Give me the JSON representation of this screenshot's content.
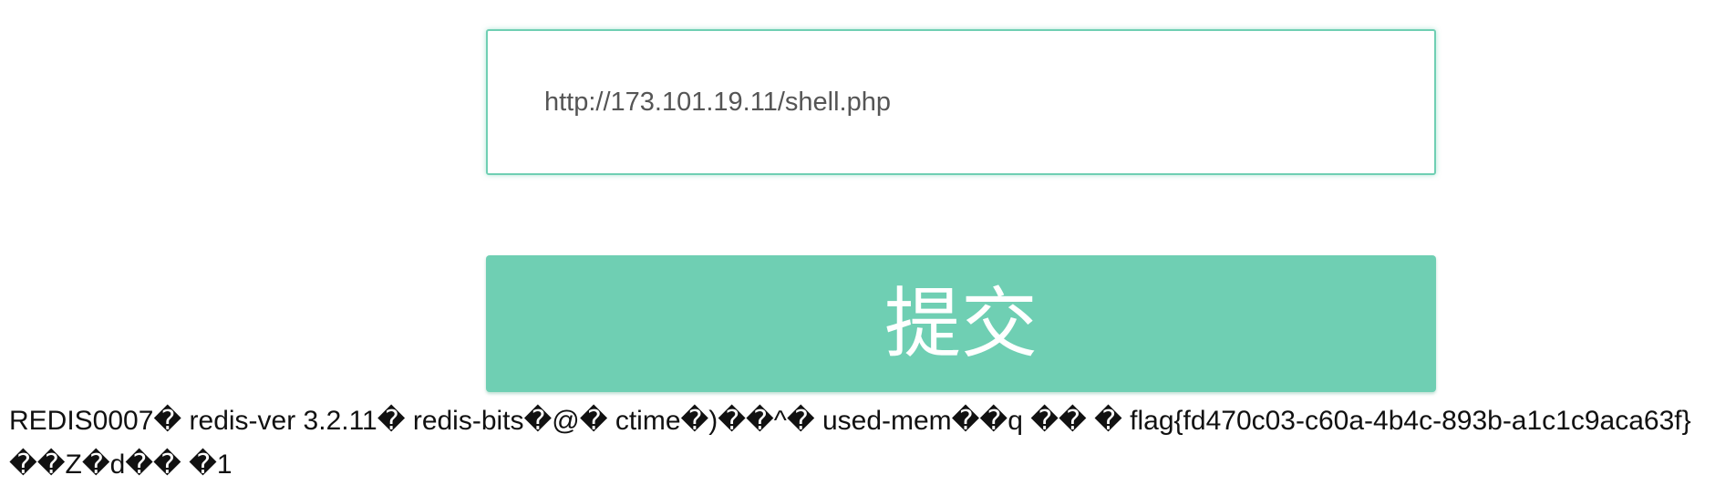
{
  "form": {
    "url_value": "http://173.101.19.11/shell.php",
    "submit_label": "提交"
  },
  "response": {
    "text": "REDIS0007� redis-ver 3.2.11� redis-bits�@� ctime�)��^� used-mem��q �� �  flag{fd470c03-c60a-4b4c-893b-a1c1c9aca63f} ��Z�d�� �1"
  },
  "colors": {
    "accent": "#6fcfb3",
    "input_border": "#6fcfb3",
    "button_text": "#ffffff",
    "body_text": "#111111"
  }
}
